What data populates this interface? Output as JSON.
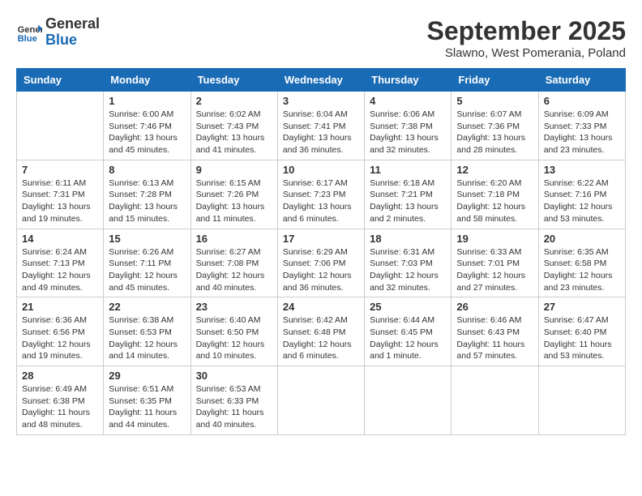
{
  "header": {
    "logo_line1": "General",
    "logo_line2": "Blue",
    "month_title": "September 2025",
    "subtitle": "Slawno, West Pomerania, Poland"
  },
  "weekdays": [
    "Sunday",
    "Monday",
    "Tuesday",
    "Wednesday",
    "Thursday",
    "Friday",
    "Saturday"
  ],
  "weeks": [
    [
      {
        "day": "",
        "info": ""
      },
      {
        "day": "1",
        "info": "Sunrise: 6:00 AM\nSunset: 7:46 PM\nDaylight: 13 hours\nand 45 minutes."
      },
      {
        "day": "2",
        "info": "Sunrise: 6:02 AM\nSunset: 7:43 PM\nDaylight: 13 hours\nand 41 minutes."
      },
      {
        "day": "3",
        "info": "Sunrise: 6:04 AM\nSunset: 7:41 PM\nDaylight: 13 hours\nand 36 minutes."
      },
      {
        "day": "4",
        "info": "Sunrise: 6:06 AM\nSunset: 7:38 PM\nDaylight: 13 hours\nand 32 minutes."
      },
      {
        "day": "5",
        "info": "Sunrise: 6:07 AM\nSunset: 7:36 PM\nDaylight: 13 hours\nand 28 minutes."
      },
      {
        "day": "6",
        "info": "Sunrise: 6:09 AM\nSunset: 7:33 PM\nDaylight: 13 hours\nand 23 minutes."
      }
    ],
    [
      {
        "day": "7",
        "info": "Sunrise: 6:11 AM\nSunset: 7:31 PM\nDaylight: 13 hours\nand 19 minutes."
      },
      {
        "day": "8",
        "info": "Sunrise: 6:13 AM\nSunset: 7:28 PM\nDaylight: 13 hours\nand 15 minutes."
      },
      {
        "day": "9",
        "info": "Sunrise: 6:15 AM\nSunset: 7:26 PM\nDaylight: 13 hours\nand 11 minutes."
      },
      {
        "day": "10",
        "info": "Sunrise: 6:17 AM\nSunset: 7:23 PM\nDaylight: 13 hours\nand 6 minutes."
      },
      {
        "day": "11",
        "info": "Sunrise: 6:18 AM\nSunset: 7:21 PM\nDaylight: 13 hours\nand 2 minutes."
      },
      {
        "day": "12",
        "info": "Sunrise: 6:20 AM\nSunset: 7:18 PM\nDaylight: 12 hours\nand 58 minutes."
      },
      {
        "day": "13",
        "info": "Sunrise: 6:22 AM\nSunset: 7:16 PM\nDaylight: 12 hours\nand 53 minutes."
      }
    ],
    [
      {
        "day": "14",
        "info": "Sunrise: 6:24 AM\nSunset: 7:13 PM\nDaylight: 12 hours\nand 49 minutes."
      },
      {
        "day": "15",
        "info": "Sunrise: 6:26 AM\nSunset: 7:11 PM\nDaylight: 12 hours\nand 45 minutes."
      },
      {
        "day": "16",
        "info": "Sunrise: 6:27 AM\nSunset: 7:08 PM\nDaylight: 12 hours\nand 40 minutes."
      },
      {
        "day": "17",
        "info": "Sunrise: 6:29 AM\nSunset: 7:06 PM\nDaylight: 12 hours\nand 36 minutes."
      },
      {
        "day": "18",
        "info": "Sunrise: 6:31 AM\nSunset: 7:03 PM\nDaylight: 12 hours\nand 32 minutes."
      },
      {
        "day": "19",
        "info": "Sunrise: 6:33 AM\nSunset: 7:01 PM\nDaylight: 12 hours\nand 27 minutes."
      },
      {
        "day": "20",
        "info": "Sunrise: 6:35 AM\nSunset: 6:58 PM\nDaylight: 12 hours\nand 23 minutes."
      }
    ],
    [
      {
        "day": "21",
        "info": "Sunrise: 6:36 AM\nSunset: 6:56 PM\nDaylight: 12 hours\nand 19 minutes."
      },
      {
        "day": "22",
        "info": "Sunrise: 6:38 AM\nSunset: 6:53 PM\nDaylight: 12 hours\nand 14 minutes."
      },
      {
        "day": "23",
        "info": "Sunrise: 6:40 AM\nSunset: 6:50 PM\nDaylight: 12 hours\nand 10 minutes."
      },
      {
        "day": "24",
        "info": "Sunrise: 6:42 AM\nSunset: 6:48 PM\nDaylight: 12 hours\nand 6 minutes."
      },
      {
        "day": "25",
        "info": "Sunrise: 6:44 AM\nSunset: 6:45 PM\nDaylight: 12 hours\nand 1 minute."
      },
      {
        "day": "26",
        "info": "Sunrise: 6:46 AM\nSunset: 6:43 PM\nDaylight: 11 hours\nand 57 minutes."
      },
      {
        "day": "27",
        "info": "Sunrise: 6:47 AM\nSunset: 6:40 PM\nDaylight: 11 hours\nand 53 minutes."
      }
    ],
    [
      {
        "day": "28",
        "info": "Sunrise: 6:49 AM\nSunset: 6:38 PM\nDaylight: 11 hours\nand 48 minutes."
      },
      {
        "day": "29",
        "info": "Sunrise: 6:51 AM\nSunset: 6:35 PM\nDaylight: 11 hours\nand 44 minutes."
      },
      {
        "day": "30",
        "info": "Sunrise: 6:53 AM\nSunset: 6:33 PM\nDaylight: 11 hours\nand 40 minutes."
      },
      {
        "day": "",
        "info": ""
      },
      {
        "day": "",
        "info": ""
      },
      {
        "day": "",
        "info": ""
      },
      {
        "day": "",
        "info": ""
      }
    ]
  ]
}
